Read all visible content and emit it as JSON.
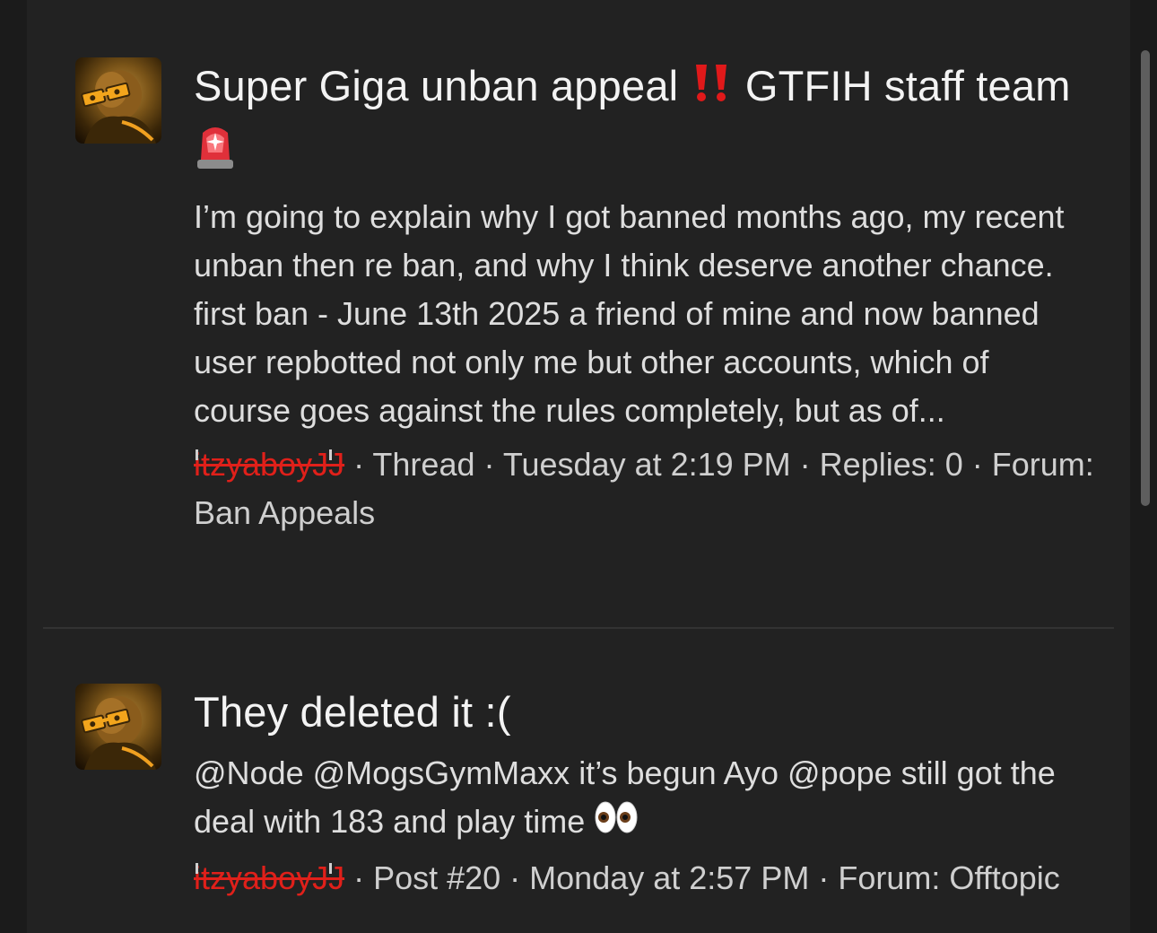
{
  "results": [
    {
      "title_part1": "Super Giga unban appeal ",
      "title_part2": " GTFIH staff team ",
      "title_icon_1": "double-exclamation-icon",
      "title_icon_2": "police-light-icon",
      "snippet": "I’m going to explain why I got banned months ago, my recent unban then re ban, and why I think deserve another chance. first ban - June 13th 2025 a friend of mine and now banned user repbotted not only me but other accounts, which of course goes against the rules completely, but as of...",
      "author": "itzyaboyJJ",
      "meta_rest": " · Thread · Tuesday at 2:19 PM · Replies: 0 · Forum: Ban Appeals"
    },
    {
      "title_part1": "They deleted it :(",
      "snippet": "@Node @MogsGymMaxx it’s begun Ayo @pope still got the deal with 183 and play time ",
      "snippet_icon": "eyes-icon",
      "author": "itzyaboyJJ",
      "meta_rest": " · Post #20 · Monday at 2:57 PM · Forum: Offtopic"
    }
  ],
  "colors": {
    "background": "#222222",
    "outer_background": "#1b1b1b",
    "banned_username": "#e0201a",
    "divider": "#333333"
  }
}
